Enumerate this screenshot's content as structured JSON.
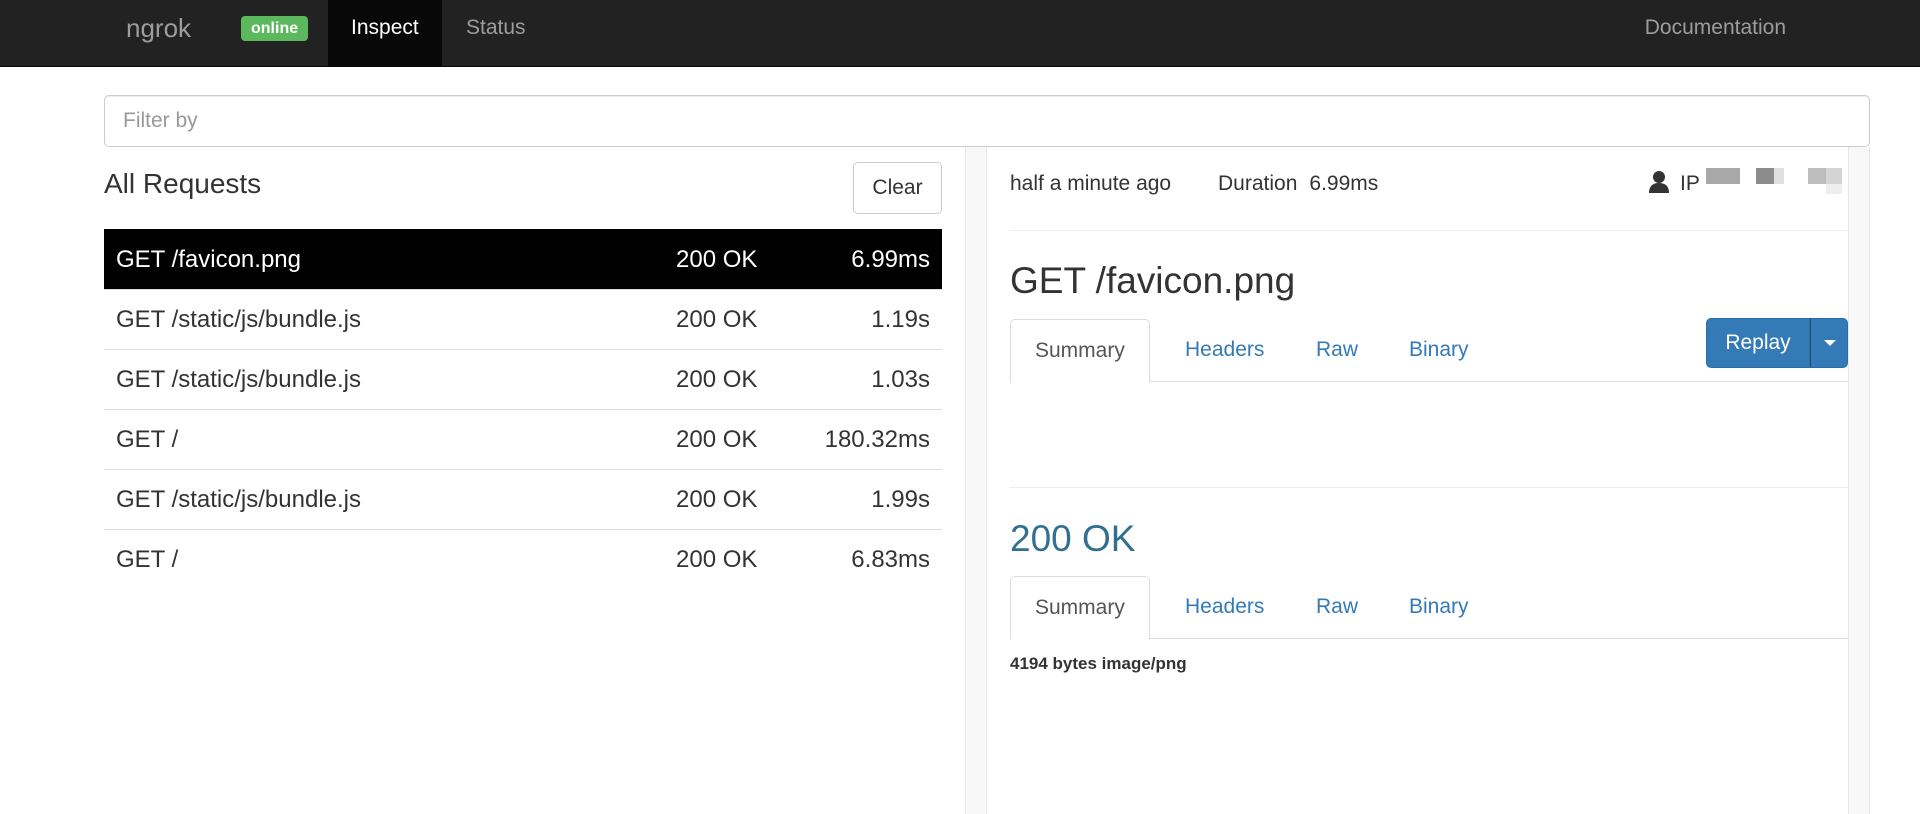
{
  "navbar": {
    "brand": "ngrok",
    "badge": "online",
    "tabs": [
      "Inspect",
      "Status"
    ],
    "docs": "Documentation"
  },
  "filter": {
    "placeholder": "Filter by",
    "value": ""
  },
  "requests": {
    "title": "All Requests",
    "clear_label": "Clear",
    "rows": [
      {
        "path": "GET /favicon.png",
        "status": "200 OK",
        "duration": "6.99ms",
        "selected": true
      },
      {
        "path": "GET /static/js/bundle.js",
        "status": "200 OK",
        "duration": "1.19s",
        "selected": false
      },
      {
        "path": "GET /static/js/bundle.js",
        "status": "200 OK",
        "duration": "1.03s",
        "selected": false
      },
      {
        "path": "GET /",
        "status": "200 OK",
        "duration": "180.32ms",
        "selected": false
      },
      {
        "path": "GET /static/js/bundle.js",
        "status": "200 OK",
        "duration": "1.99s",
        "selected": false
      },
      {
        "path": "GET /",
        "status": "200 OK",
        "duration": "6.83ms",
        "selected": false
      }
    ]
  },
  "detail": {
    "time_ago": "half a minute ago",
    "duration_label": "Duration",
    "duration_value": "6.99ms",
    "ip_label": "IP",
    "request_title": "GET /favicon.png",
    "request_tabs": [
      "Summary",
      "Headers",
      "Raw",
      "Binary"
    ],
    "replay_label": "Replay",
    "response_status": "200 OK",
    "response_tabs": [
      "Summary",
      "Headers",
      "Raw",
      "Binary"
    ],
    "response_summary": "4194 bytes image/png"
  },
  "colors": {
    "navbar_bg": "#222222",
    "badge_success": "#5cb85c",
    "link": "#337ab7",
    "primary": "#337ab7",
    "status_info": "#31708f"
  }
}
